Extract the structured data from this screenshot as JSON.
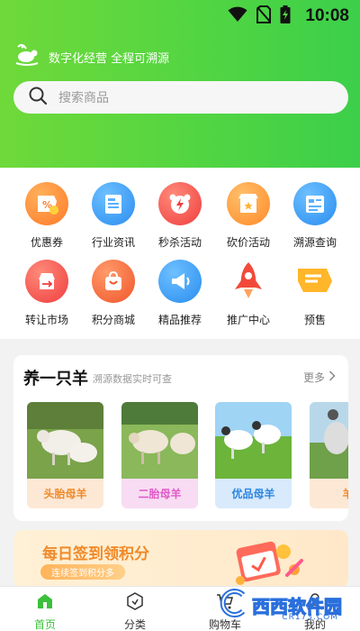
{
  "status_bar": {
    "time": "10:08"
  },
  "header": {
    "brand_text": "数字化经营 全程可溯源",
    "search_placeholder": "搜索商品"
  },
  "grid": [
    {
      "label": "优惠券",
      "icon": "coupon-icon",
      "color": "#ff8a3d"
    },
    {
      "label": "行业资讯",
      "icon": "news-icon",
      "color": "#3a9cf5"
    },
    {
      "label": "秒杀活动",
      "icon": "flash-sale-icon",
      "color": "#f25a4a"
    },
    {
      "label": "砍价活动",
      "icon": "store-icon",
      "color": "#ff9e3a"
    },
    {
      "label": "溯源查询",
      "icon": "trace-query-icon",
      "color": "#3a9cf5"
    },
    {
      "label": "转让市场",
      "icon": "transfer-market-icon",
      "color": "#f25a4a"
    },
    {
      "label": "积分商城",
      "icon": "points-mall-icon",
      "color": "#ff7a3a"
    },
    {
      "label": "精品推荐",
      "icon": "megaphone-icon",
      "color": "#3a9cf5"
    },
    {
      "label": "推广中心",
      "icon": "rocket-icon",
      "color": "#f25a4a"
    },
    {
      "label": "预售",
      "icon": "presale-icon",
      "color": "#ffb23a"
    }
  ],
  "sheep_section": {
    "title": "养一只羊",
    "subtitle": "溯源数据实时可查",
    "more": "更多",
    "items": [
      {
        "label": "头胎母羊",
        "label_color": "#f08a2a",
        "label_bg": "#fde8d6"
      },
      {
        "label": "二胎母羊",
        "label_color": "#e15ac8",
        "label_bg": "#f8dcf3"
      },
      {
        "label": "优品母羊",
        "label_color": "#2f86e0",
        "label_bg": "#d8eafc"
      },
      {
        "label": "羊",
        "label_color": "#f08a2a",
        "label_bg": "#fde8d6"
      }
    ]
  },
  "banner": {
    "title": "每日签到领积分",
    "button": "连续签到积分多"
  },
  "tabbar": {
    "tabs": [
      {
        "label": "首页",
        "icon": "home-icon",
        "active": true
      },
      {
        "label": "分类",
        "icon": "category-icon",
        "active": false
      },
      {
        "label": "购物车",
        "icon": "cart-icon",
        "active": false
      },
      {
        "label": "我的",
        "icon": "profile-icon",
        "active": false
      }
    ]
  },
  "watermark": {
    "text": "西西软件园",
    "sub": "CR173.COM"
  },
  "colors": {
    "accent": "#55d641",
    "active_tab": "#3cbf3c"
  }
}
